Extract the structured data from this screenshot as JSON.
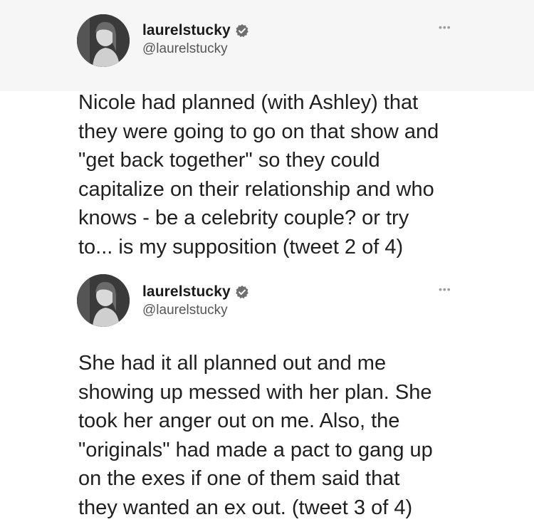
{
  "tweets": [
    {
      "display_name": "laurelstucky",
      "username": "@laurelstucky",
      "more_label": "•••",
      "verified_icon": "verified-badge-icon",
      "lines": [
        "Nicole had planned (with Ashley) that",
        "they were going to go on that show and",
        "\"get back together\" so they could",
        "capitalize on their relationship and who",
        "knows - be a celebrity couple? or try",
        "to... is my supposition (tweet 2 of 4)"
      ]
    },
    {
      "display_name": "laurelstucky",
      "username": "@laurelstucky",
      "more_label": "•••",
      "verified_icon": "verified-badge-icon",
      "lines": [
        "She had it all planned out and me",
        "showing up messed with her plan. She",
        "took her anger out on me. Also, the",
        "\"originals\" had made a pact to gang up",
        "on the exes if one of them said that",
        "they wanted an ex out. (tweet 3 of 4)"
      ]
    }
  ]
}
